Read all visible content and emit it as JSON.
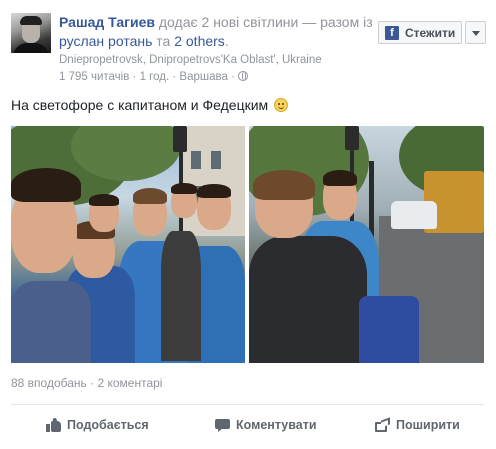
{
  "post": {
    "author": "Рашад Тагиев",
    "action_text": "додає 2 нові світлини — разом із",
    "tagged_person": "руслан ротань",
    "and_text": "та",
    "others_text": "2 others",
    "others_suffix": ".",
    "location": "Dniepropetrovsk, Dnipropetrovs'Ka Oblast', Ukraine",
    "readers": "1 795 читачів",
    "separator": "·",
    "time": "1 год.",
    "city": "Варшава",
    "privacy_icon": "globe-icon",
    "status": "На светофоре с капитаном и Федецким",
    "emoji": "smile-emoji"
  },
  "follow_button": {
    "label": "Стежити",
    "icon": "facebook-f-icon"
  },
  "menu_button": {
    "icon": "chevron-down-icon"
  },
  "photos": [
    {
      "name": "photo-group-selfie",
      "description_icon": "photo"
    },
    {
      "name": "photo-autograph",
      "description_icon": "photo"
    }
  ],
  "stats": {
    "likes": "88 вподобань",
    "separator": "·",
    "comments": "2 коментарі"
  },
  "actions": {
    "like_label": "Подобається",
    "comment_label": "Коментувати",
    "share_label": "Поширити"
  },
  "colors": {
    "link": "#365899",
    "muted": "#90949c",
    "action_text": "#616770",
    "facebook_blue": "#3b5998"
  }
}
